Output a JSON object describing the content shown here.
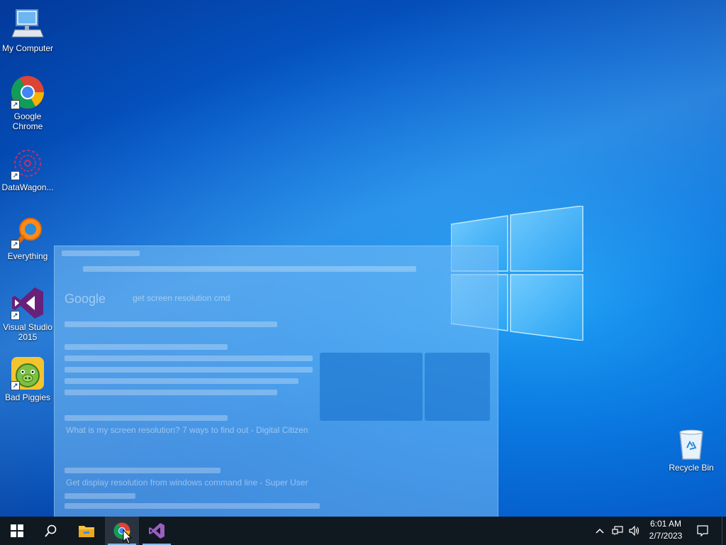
{
  "desktop": {
    "icons": [
      {
        "label": "My Computer"
      },
      {
        "label": "Google Chrome"
      },
      {
        "label": "DataWagon..."
      },
      {
        "label": "Everything"
      },
      {
        "label": "Visual Studio 2015"
      },
      {
        "label": "Bad Piggies"
      },
      {
        "label": "Recycle Bin"
      }
    ]
  },
  "ghost_window": {
    "search_query": "get screen resolution cmd",
    "results": [
      "What is my screen resolution? 7 ways to find out - Digital Citizen",
      "Get display resolution from windows command line - Super User"
    ]
  },
  "taskbar": {
    "time": "6:01 AM",
    "date": "2/7/2023"
  },
  "colors": {
    "desktop_accent": "#0a78e0",
    "taskbar": "#101820"
  }
}
